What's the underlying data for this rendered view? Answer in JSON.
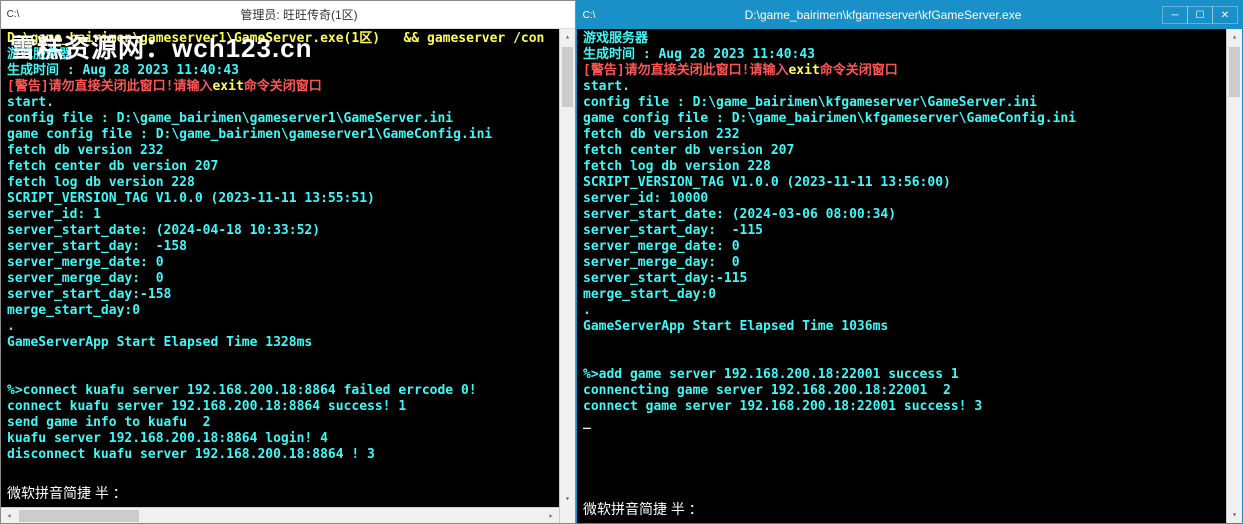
{
  "watermark": {
    "cn": "雪糕资源网：",
    "url": "wch123.cn"
  },
  "ime": "微软拼音简捷 半 ：",
  "left": {
    "title": "管理员: 旺旺传奇(1区)",
    "icon_label": "C:\\",
    "lines": [
      {
        "cls": "c-yellow",
        "t": "D:\\game_bairimen\\gameserver1\\GameServer.exe(1区)   && gameserver /con"
      },
      {
        "cls": "c-cyan",
        "t": "游戏服务器"
      },
      {
        "cls": "c-cyan",
        "t": "生成时间 : Aug 28 2023 11:40:43"
      },
      {
        "parts": [
          {
            "cls": "c-red",
            "t": "[警告]请勿直接关闭此窗口!请输入"
          },
          {
            "cls": "c-yellow",
            "t": "exit"
          },
          {
            "cls": "c-red",
            "t": "命令关闭窗口"
          }
        ]
      },
      {
        "cls": "c-cyan",
        "t": "start."
      },
      {
        "cls": "c-cyan",
        "t": "config file : D:\\game_bairimen\\gameserver1\\GameServer.ini"
      },
      {
        "cls": "c-cyan",
        "t": "game config file : D:\\game_bairimen\\gameserver1\\GameConfig.ini"
      },
      {
        "cls": "c-cyan",
        "t": "fetch db version 232"
      },
      {
        "cls": "c-cyan",
        "t": "fetch center db version 207"
      },
      {
        "cls": "c-cyan",
        "t": "fetch log db version 228"
      },
      {
        "cls": "c-cyan",
        "t": "SCRIPT_VERSION_TAG V1.0.0 (2023-11-11 13:55:51)"
      },
      {
        "cls": "c-cyan",
        "t": "server_id: 1"
      },
      {
        "cls": "c-cyan",
        "t": "server_start_date: (2024-04-18 10:33:52)"
      },
      {
        "cls": "c-cyan",
        "t": "server_start_day:  -158"
      },
      {
        "cls": "c-cyan",
        "t": "server_merge_date: 0"
      },
      {
        "cls": "c-cyan",
        "t": "server_merge_day:  0"
      },
      {
        "cls": "c-cyan",
        "t": "server_start_day:-158"
      },
      {
        "cls": "c-cyan",
        "t": "merge_start_day:0"
      },
      {
        "cls": "c-cyan",
        "t": "."
      },
      {
        "cls": "c-cyan",
        "t": "GameServerApp Start Elapsed Time 1328ms"
      },
      {
        "cls": "c-cyan",
        "t": " "
      },
      {
        "cls": "c-cyan",
        "t": " "
      },
      {
        "cls": "c-cyan",
        "t": "%>connect kuafu server 192.168.200.18:8864 failed errcode 0!"
      },
      {
        "cls": "c-cyan",
        "t": "connect kuafu server 192.168.200.18:8864 success! 1"
      },
      {
        "cls": "c-cyan",
        "t": "send game info to kuafu  2"
      },
      {
        "cls": "c-cyan",
        "t": "kuafu server 192.168.200.18:8864 login! 4"
      },
      {
        "cls": "c-cyan",
        "t": "disconnect kuafu server 192.168.200.18:8864 ! 3"
      }
    ]
  },
  "right": {
    "title": "D:\\game_bairimen\\kfgameserver\\kfGameServer.exe",
    "icon_label": "C:\\",
    "lines": [
      {
        "cls": "c-cyan",
        "t": "游戏服务器"
      },
      {
        "cls": "c-cyan",
        "t": "生成时间 : Aug 28 2023 11:40:43"
      },
      {
        "parts": [
          {
            "cls": "c-red",
            "t": "[警告]请勿直接关闭此窗口!请输入"
          },
          {
            "cls": "c-yellow",
            "t": "exit"
          },
          {
            "cls": "c-red",
            "t": "命令关闭窗口"
          }
        ]
      },
      {
        "cls": "c-cyan",
        "t": "start."
      },
      {
        "cls": "c-cyan",
        "t": "config file : D:\\game_bairimen\\kfgameserver\\GameServer.ini"
      },
      {
        "cls": "c-cyan",
        "t": "game config file : D:\\game_bairimen\\kfgameserver\\GameConfig.ini"
      },
      {
        "cls": "c-cyan",
        "t": "fetch db version 232"
      },
      {
        "cls": "c-cyan",
        "t": "fetch center db version 207"
      },
      {
        "cls": "c-cyan",
        "t": "fetch log db version 228"
      },
      {
        "cls": "c-cyan",
        "t": "SCRIPT_VERSION_TAG V1.0.0 (2023-11-11 13:56:00)"
      },
      {
        "cls": "c-cyan",
        "t": "server_id: 10000"
      },
      {
        "cls": "c-cyan",
        "t": "server_start_date: (2024-03-06 08:00:34)"
      },
      {
        "cls": "c-cyan",
        "t": "server_start_day:  -115"
      },
      {
        "cls": "c-cyan",
        "t": "server_merge_date: 0"
      },
      {
        "cls": "c-cyan",
        "t": "server_merge_day:  0"
      },
      {
        "cls": "c-cyan",
        "t": "server_start_day:-115"
      },
      {
        "cls": "c-cyan",
        "t": "merge_start_day:0"
      },
      {
        "cls": "c-cyan",
        "t": "."
      },
      {
        "cls": "c-cyan",
        "t": "GameServerApp Start Elapsed Time 1036ms"
      },
      {
        "cls": "c-cyan",
        "t": " "
      },
      {
        "cls": "c-cyan",
        "t": " "
      },
      {
        "cls": "c-cyan",
        "t": "%>add game server 192.168.200.18:22001 success 1"
      },
      {
        "cls": "c-cyan",
        "t": "connencting game server 192.168.200.18:22001  2"
      },
      {
        "cls": "c-cyan",
        "t": "connect game server 192.168.200.18:22001 success! 3"
      },
      {
        "cls": "c-white",
        "t": "_"
      }
    ]
  }
}
